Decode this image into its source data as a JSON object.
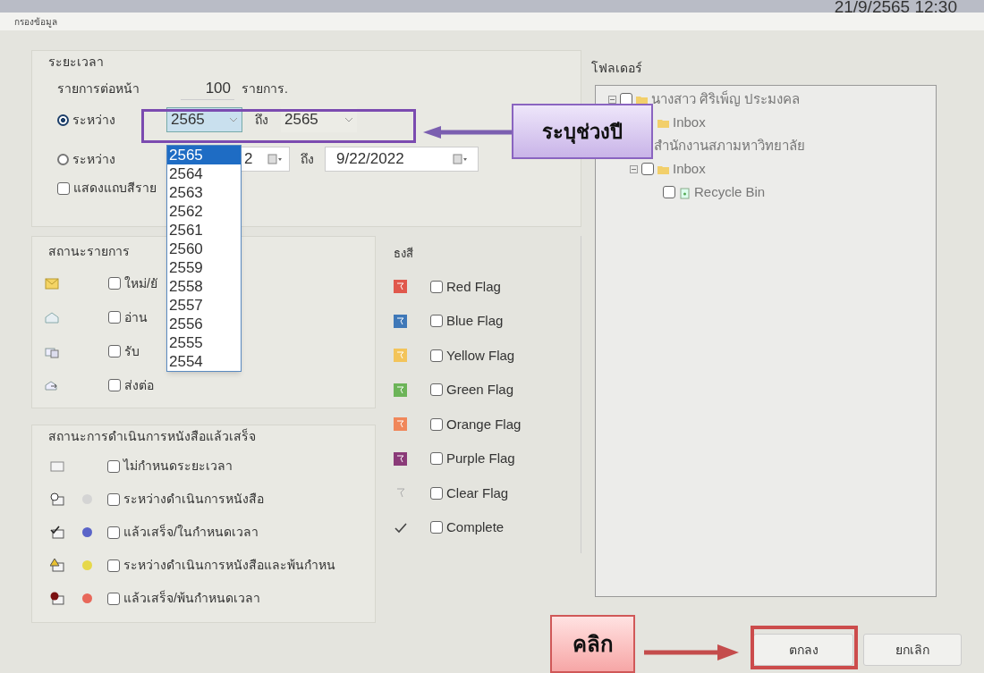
{
  "taskbar": {
    "clock": "21/9/2565 12:30"
  },
  "window": {
    "title": "กรองข้อมูล"
  },
  "period": {
    "title": "ระยะเวลา",
    "per_page_label": "รายการต่อหน้า",
    "per_page_value": "100",
    "per_page_unit": "รายการ.",
    "options": [
      {
        "kind": "year",
        "label": "ระหว่าง",
        "selected": true,
        "from": "2565",
        "to_label": "ถึง",
        "to": "2565"
      },
      {
        "kind": "date",
        "label": "ระหว่าง",
        "selected": false,
        "from": "2",
        "to_label": "ถึง",
        "to": "9/22/2022"
      }
    ],
    "color_bar": {
      "label": "แสดงแถบสีราย",
      "checked": false
    }
  },
  "year_dropdown": [
    {
      "label": "2565",
      "selected": true
    },
    {
      "label": "2564",
      "selected": false
    },
    {
      "label": "2563",
      "selected": false
    },
    {
      "label": "2562",
      "selected": false
    },
    {
      "label": "2561",
      "selected": false
    },
    {
      "label": "2560",
      "selected": false
    },
    {
      "label": "2559",
      "selected": false
    },
    {
      "label": "2558",
      "selected": false
    },
    {
      "label": "2557",
      "selected": false
    },
    {
      "label": "2556",
      "selected": false
    },
    {
      "label": "2555",
      "selected": false
    },
    {
      "label": "2554",
      "selected": false
    }
  ],
  "item_status": {
    "title": "สถานะรายการ",
    "items": [
      {
        "kind": "new",
        "label": "ใหม่/ยั",
        "checked": false
      },
      {
        "kind": "read",
        "label": "อ่าน",
        "checked": false
      },
      {
        "kind": "received",
        "label": "รับ",
        "checked": false
      },
      {
        "kind": "forwarded",
        "label": "ส่งต่อ",
        "checked": false
      }
    ]
  },
  "flags": {
    "title": "ธงสี",
    "items": [
      {
        "kind": "flag",
        "color": "#e0584c",
        "label": "Red Flag",
        "checked": false
      },
      {
        "kind": "flag",
        "color": "#3f78b8",
        "label": "Blue Flag",
        "checked": false
      },
      {
        "kind": "flag",
        "color": "#f3c45a",
        "label": "Yellow Flag",
        "checked": false
      },
      {
        "kind": "flag",
        "color": "#6cb458",
        "label": "Green Flag",
        "checked": false
      },
      {
        "kind": "flag",
        "color": "#f0875a",
        "label": "Orange Flag",
        "checked": false
      },
      {
        "kind": "flag",
        "color": "#8a3a78",
        "label": "Purple Flag",
        "checked": false
      },
      {
        "kind": "clear",
        "label": "Clear Flag",
        "checked": false
      },
      {
        "kind": "complete",
        "label": "Complete",
        "checked": false
      }
    ]
  },
  "doc_status": {
    "title": "สถานะการดำเนินการหนังสือแล้วเสร็จ",
    "items": [
      {
        "kind": "no_deadline",
        "label": "ไม่กำหนดระยะเวลา",
        "checked": false
      },
      {
        "kind": "in_progress",
        "color": "#d4d4d4",
        "label": "ระหว่างดำเนินการหนังสือ",
        "checked": false
      },
      {
        "kind": "done",
        "color": "#5a64c8",
        "label": "แล้วเสร็จ/ในกำหนดเวลา",
        "checked": false
      },
      {
        "kind": "warning",
        "color": "#e6d84a",
        "label": "ระหว่างดำเนินการหนังสือและพ้นกำหน",
        "checked": false
      },
      {
        "kind": "overdue",
        "color": "#e8685a",
        "label": "แล้วเสร็จ/พ้นกำหนดเวลา",
        "checked": false
      }
    ]
  },
  "folders": {
    "title": "โฟลเดอร์",
    "tree": [
      {
        "label": "นางสาว ศิริเพ็ญ ประมงคล",
        "kind": "user",
        "checked": false,
        "expanded": true,
        "children": [
          {
            "label": "Inbox",
            "kind": "folder"
          }
        ]
      },
      {
        "label": "สำนักงานสภามหาวิทยาลัย",
        "children": [
          {
            "label": "Inbox",
            "kind": "folder",
            "checked": false,
            "expanded": true,
            "children": [
              {
                "label": "Recycle Bin",
                "kind": "bin",
                "checked": false
              }
            ]
          }
        ]
      }
    ]
  },
  "buttons": [
    {
      "kind": "ok",
      "label": "ตกลง"
    },
    {
      "kind": "cancel",
      "label": "ยกเลิก"
    }
  ],
  "annotations": [
    {
      "kind": "purple",
      "label": "ระบุช่วงปี"
    },
    {
      "kind": "red",
      "label": "คลิก"
    }
  ]
}
